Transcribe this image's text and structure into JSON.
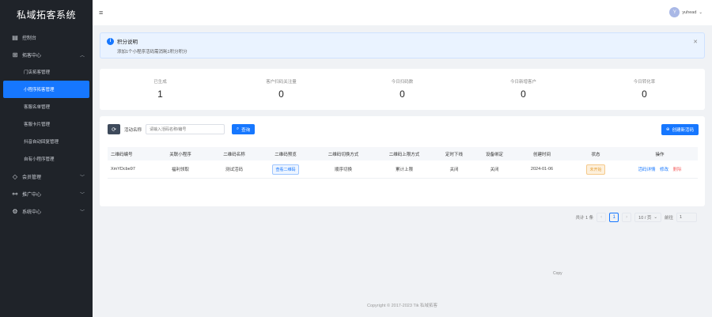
{
  "app_title": "私域拓客系统",
  "sidebar": {
    "items": [
      {
        "label": "控制台",
        "icon": "dashboard-icon"
      },
      {
        "label": "拓客中心",
        "icon": "grid-icon",
        "expanded": true,
        "children": [
          {
            "label": "门店拓客管理"
          },
          {
            "label": "小程序拓客管理",
            "active": true
          },
          {
            "label": "客服名单管理"
          },
          {
            "label": "客服卡片管理"
          },
          {
            "label": "抖音自动回复管理"
          },
          {
            "label": "自有小程序管理"
          }
        ]
      },
      {
        "label": "会员管理",
        "icon": "diamond-icon"
      },
      {
        "label": "推广中心",
        "icon": "share-icon"
      },
      {
        "label": "系统中心",
        "icon": "gear-icon"
      }
    ]
  },
  "topbar": {
    "hamburger_icon": "menu-icon",
    "user_initial": "Y",
    "user_name": "yuhead"
  },
  "alert": {
    "title": "积分说明",
    "description": "添加1个小程序活码需消耗1积分积分"
  },
  "stats": [
    {
      "label": "已生成",
      "value": "1"
    },
    {
      "label": "客户扫码关注量",
      "value": "0"
    },
    {
      "label": "今日扫码数",
      "value": "0"
    },
    {
      "label": "今日新增客户",
      "value": "0"
    },
    {
      "label": "今日转化率",
      "value": "0"
    }
  ],
  "toolbar": {
    "field_label": "活动名称",
    "search_placeholder": "请输入活码名称/编号",
    "query_label": "查询",
    "create_label": "创建新活码"
  },
  "table": {
    "headers": [
      "二维码编号",
      "关联小程序",
      "二维码名称",
      "二维码预览",
      "二维码切换方式",
      "二维码上限方式",
      "定时下线",
      "设备绑定",
      "创建时间",
      "状态",
      "操作"
    ],
    "rows": [
      {
        "code": "XmYDcbe97",
        "miniprogram": "福利领取",
        "name": "测试活码",
        "preview": "查看二维码",
        "switch_mode": "顺序切换",
        "limit_mode": "累计上限",
        "timed_offline": "关闭",
        "device_binding": "关闭",
        "created": "2024-01-06",
        "status": "未开始",
        "actions": [
          "活码详情",
          "修改",
          "删除"
        ]
      }
    ]
  },
  "pagination": {
    "total_text": "共计 1 条",
    "current_page": "1",
    "page_size": "10 / 页",
    "jump_label": "前往",
    "jump_value": "1"
  },
  "stray_text": "Copy",
  "footer": "Copyright © 2017-2023 Tik 私域拓客"
}
